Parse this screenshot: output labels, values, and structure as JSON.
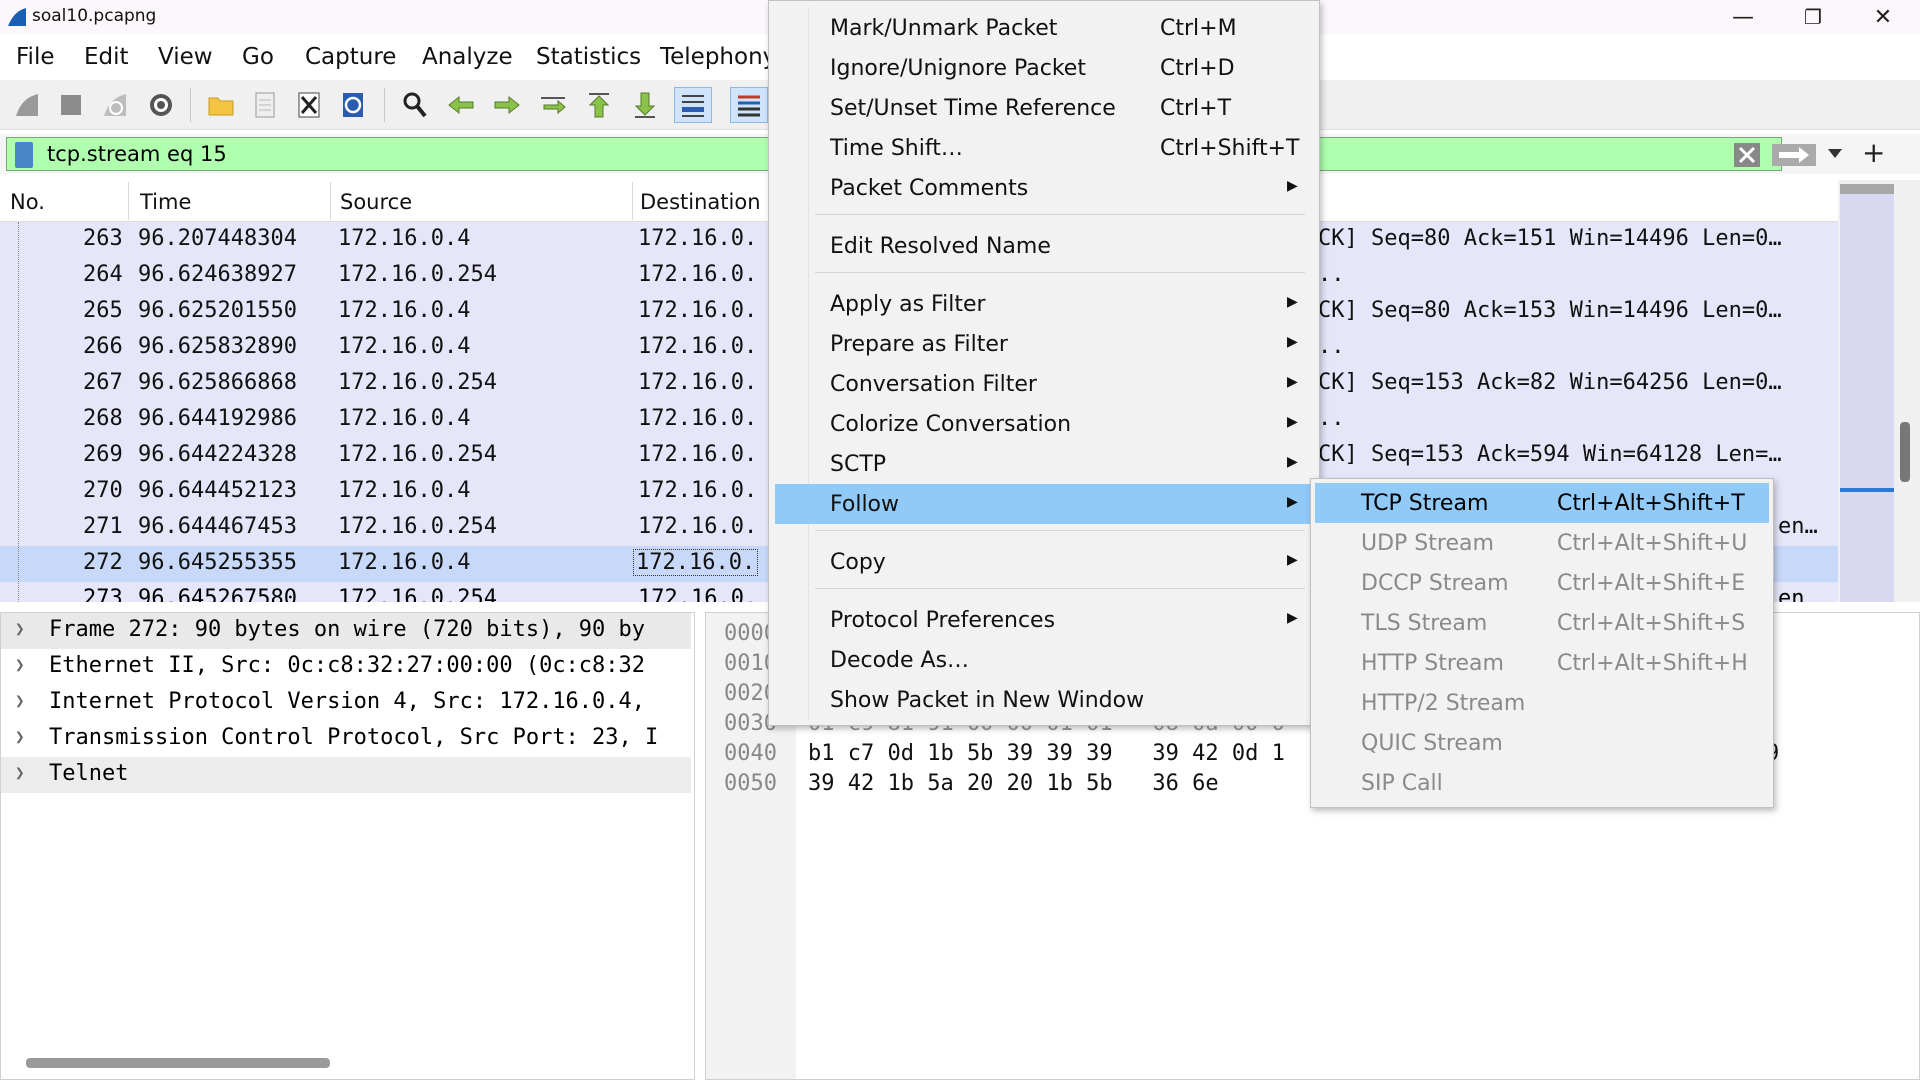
{
  "window": {
    "title": "soal10.pcapng",
    "minimize": "—",
    "maximize": "❐",
    "close": "✕"
  },
  "menubar": [
    "File",
    "Edit",
    "View",
    "Go",
    "Capture",
    "Analyze",
    "Statistics",
    "Telephony"
  ],
  "filter": {
    "value": "tcp.stream eq 15",
    "add_label": "+"
  },
  "packet_list": {
    "columns": [
      "No.",
      "Time",
      "Source",
      "Destination"
    ],
    "rows": [
      {
        "no": "263",
        "time": "96.207448304",
        "src": "172.16.0.4",
        "dst": "172.16.0.",
        "info": "CK] Seq=80 Ack=151 Win=14496 Len=0…"
      },
      {
        "no": "264",
        "time": "96.624638927",
        "src": "172.16.0.254",
        "dst": "172.16.0.",
        "info": ".."
      },
      {
        "no": "265",
        "time": "96.625201550",
        "src": "172.16.0.4",
        "dst": "172.16.0.",
        "info": "CK] Seq=80 Ack=153 Win=14496 Len=0…"
      },
      {
        "no": "266",
        "time": "96.625832890",
        "src": "172.16.0.4",
        "dst": "172.16.0.",
        "info": ".."
      },
      {
        "no": "267",
        "time": "96.625866868",
        "src": "172.16.0.254",
        "dst": "172.16.0.",
        "info": "CK] Seq=153 Ack=82 Win=64256 Len=0…"
      },
      {
        "no": "268",
        "time": "96.644192986",
        "src": "172.16.0.4",
        "dst": "172.16.0.",
        "info": ".."
      },
      {
        "no": "269",
        "time": "96.644224328",
        "src": "172.16.0.254",
        "dst": "172.16.0.",
        "info": "CK] Seq=153 Ack=594 Win=64128 Len=…"
      },
      {
        "no": "270",
        "time": "96.644452123",
        "src": "172.16.0.4",
        "dst": "172.16.0.",
        "info": ""
      },
      {
        "no": "271",
        "time": "96.644467453",
        "src": "172.16.0.254",
        "dst": "172.16.0.",
        "info": "en…"
      },
      {
        "no": "272",
        "time": "96.645255355",
        "src": "172.16.0.4",
        "dst": "172.16.0.",
        "info": ""
      },
      {
        "no": "273",
        "time": "96.645267580",
        "src": "172.16.0.254",
        "dst": "172.16.0.",
        "info": "en"
      }
    ]
  },
  "details": [
    "Frame 272: 90 bytes on wire (720 bits), 90 by",
    "Ethernet II, Src: 0c:c8:32:27:00:00 (0c:c8:32",
    "Internet Protocol Version 4, Src: 172.16.0.4,",
    "Transmission Control Protocol, Src Port: 23, I",
    "Telnet"
  ],
  "bytes": {
    "offsets": [
      "0000",
      "0010",
      "0020",
      "0030",
      "0040",
      "0050"
    ],
    "hex": [
      "",
      "",
      "",
      "01 c9 81 91 00 00 01 01   08 0a 00 0",
      "b1 c7 0d 1b 5b 39 39 39   39 42 0d 1",
      "39 42 1b 5a 20 20 1b 5b   36 6e"
    ],
    "ascii_tail": "9"
  },
  "context_menu": {
    "items": [
      {
        "label": "Mark/Unmark Packet",
        "shortcut": "Ctrl+M",
        "submenu": false
      },
      {
        "label": "Ignore/Unignore Packet",
        "shortcut": "Ctrl+D",
        "submenu": false
      },
      {
        "label": "Set/Unset Time Reference",
        "shortcut": "Ctrl+T",
        "submenu": false
      },
      {
        "label": "Time Shift…",
        "shortcut": "Ctrl+Shift+T",
        "submenu": false
      },
      {
        "label": "Packet Comments",
        "shortcut": "",
        "submenu": true
      },
      {
        "label": "Edit Resolved Name",
        "shortcut": "",
        "submenu": false
      },
      {
        "label": "Apply as Filter",
        "shortcut": "",
        "submenu": true
      },
      {
        "label": "Prepare as Filter",
        "shortcut": "",
        "submenu": true
      },
      {
        "label": "Conversation Filter",
        "shortcut": "",
        "submenu": true
      },
      {
        "label": "Colorize Conversation",
        "shortcut": "",
        "submenu": true
      },
      {
        "label": "SCTP",
        "shortcut": "",
        "submenu": true
      },
      {
        "label": "Follow",
        "shortcut": "",
        "submenu": true
      },
      {
        "label": "Copy",
        "shortcut": "",
        "submenu": true
      },
      {
        "label": "Protocol Preferences",
        "shortcut": "",
        "submenu": true
      },
      {
        "label": "Decode As…",
        "shortcut": "",
        "submenu": false
      },
      {
        "label": "Show Packet in New Window",
        "shortcut": "",
        "submenu": false
      }
    ]
  },
  "follow_submenu": {
    "items": [
      {
        "label": "TCP Stream",
        "shortcut": "Ctrl+Alt+Shift+T",
        "enabled": true
      },
      {
        "label": "UDP Stream",
        "shortcut": "Ctrl+Alt+Shift+U",
        "enabled": false
      },
      {
        "label": "DCCP Stream",
        "shortcut": "Ctrl+Alt+Shift+E",
        "enabled": false
      },
      {
        "label": "TLS Stream",
        "shortcut": "Ctrl+Alt+Shift+S",
        "enabled": false
      },
      {
        "label": "HTTP Stream",
        "shortcut": "Ctrl+Alt+Shift+H",
        "enabled": false
      },
      {
        "label": "HTTP/2 Stream",
        "shortcut": "",
        "enabled": false
      },
      {
        "label": "QUIC Stream",
        "shortcut": "",
        "enabled": false
      },
      {
        "label": "SIP Call",
        "shortcut": "",
        "enabled": false
      }
    ]
  },
  "colors": {
    "filter_ok": "#afffaf",
    "row_bg": "#e6e6fa",
    "row_selected": "#c8d8f8",
    "menu_highlight": "#91c9f7"
  }
}
